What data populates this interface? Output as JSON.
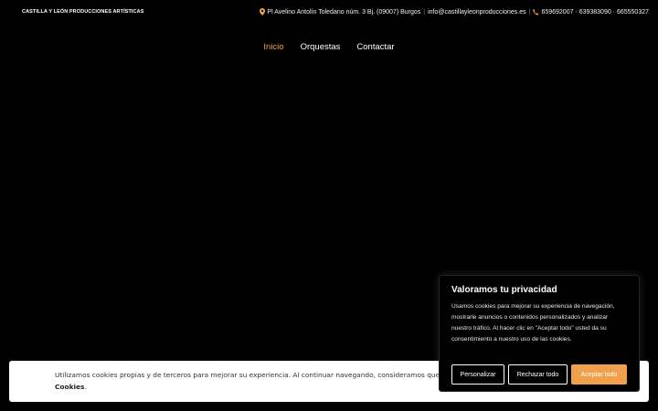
{
  "header": {
    "brand": "CASTILLA Y LEÓN PRODUCCIONES ARTÍSTICAS",
    "address": "Pl Avelino Antolín Toledano núm. 3 Bj. (09007) Burgos",
    "email": "info@castillayleonproducciones.es",
    "phones": "659692007 · 639383090 · 665550327",
    "icons": [
      "location-pin-icon",
      "phone-icon"
    ]
  },
  "nav": {
    "items": [
      {
        "label": "Inicio",
        "active": true
      },
      {
        "label": "Orquestas",
        "active": false
      },
      {
        "label": "Contactar",
        "active": false
      }
    ]
  },
  "cookie_bar": {
    "text": "Utilizamos cookies propias y de terceros para mejorar su experiencia. Al continuar navegando, consideramos que acepta su uso. Más información",
    "link": "Cookies",
    "suffix": "."
  },
  "privacy_modal": {
    "title": "Valoramos tu privacidad",
    "body": "Usamos cookies para mejorar su experiencia de navegación, mostrarle anuncios o contenidos personalizados y analizar nuestro tráfico. Al hacer clic en \"Aceptar todo\" usted da su consentimiento a nuestro uso de las cookies.",
    "buttons": {
      "customize": "Personalizar",
      "reject": "Rechazar todo",
      "accept": "Aceptar todo"
    }
  },
  "colors": {
    "accent": "#f0a04b",
    "background": "#000000"
  }
}
